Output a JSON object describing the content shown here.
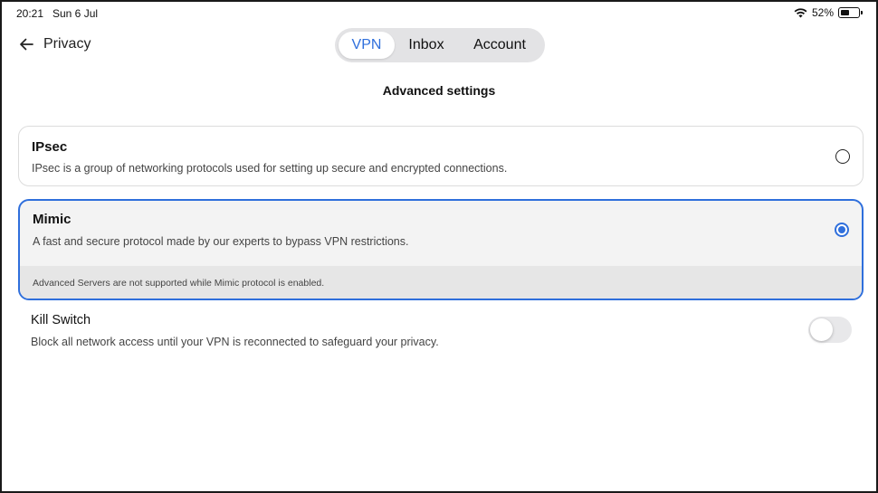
{
  "status_bar": {
    "time": "20:21",
    "date": "Sun 6 Jul",
    "battery_percent": "52%",
    "battery_level": 0.52,
    "wifi_icon": "wifi-icon",
    "battery_icon": "battery-icon"
  },
  "header": {
    "back_label": "Privacy",
    "back_icon": "arrow-left-icon",
    "tabs": [
      {
        "label": "VPN",
        "active": true
      },
      {
        "label": "Inbox",
        "active": false
      },
      {
        "label": "Account",
        "active": false
      }
    ]
  },
  "page": {
    "title": "Advanced settings"
  },
  "protocols": [
    {
      "name": "IPsec",
      "description": "IPsec is a group of networking protocols used for setting up secure and encrypted connections.",
      "selected": false
    },
    {
      "name": "Mimic",
      "description": "A fast and secure protocol made by our experts to bypass VPN restrictions.",
      "note": "Advanced Servers are not supported while Mimic protocol is enabled.",
      "selected": true
    }
  ],
  "kill_switch": {
    "title": "Kill Switch",
    "description": "Block all network access until your VPN is reconnected to safeguard your privacy.",
    "enabled": false
  },
  "colors": {
    "accent": "#2f6fdc",
    "segment_bg": "#e3e3e5",
    "selected_card_bg": "#f3f3f3",
    "note_bg": "#e6e6e6"
  }
}
